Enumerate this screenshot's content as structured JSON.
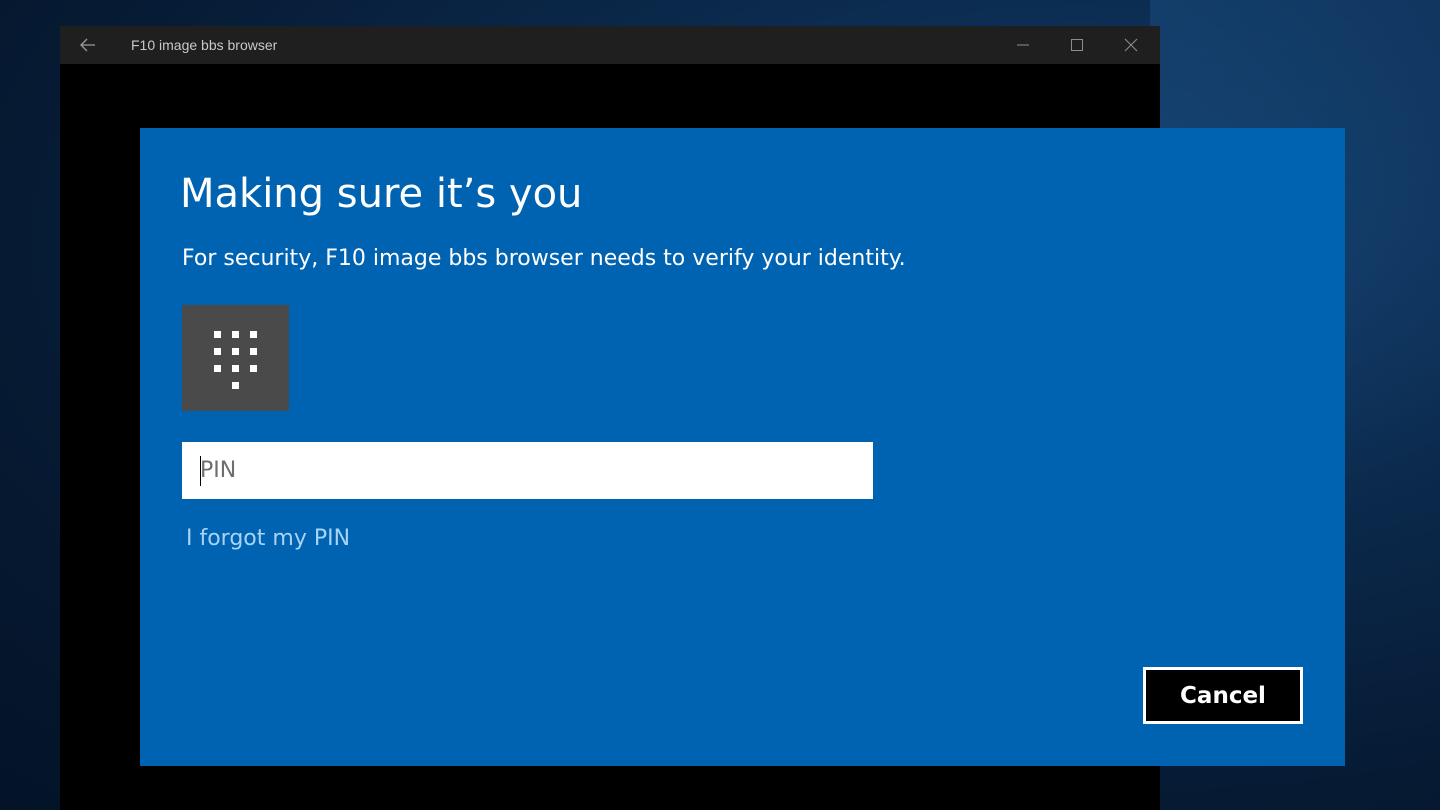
{
  "window": {
    "title": "F10 image bbs browser",
    "back_icon": "arrow-left-icon",
    "controls": [
      "minimize-icon",
      "maximize-icon",
      "close-icon"
    ]
  },
  "dialog": {
    "title": "Making sure it’s you",
    "subtitle": "For security, F10 image bbs browser needs to verify your identity.",
    "tile_icon": "pin-keypad-icon",
    "pin_input": {
      "placeholder": "PIN",
      "value": ""
    },
    "forgot_link": "I forgot my PIN",
    "cancel_label": "Cancel"
  },
  "colors": {
    "dialog_background": "#0063b1",
    "tile_background": "#4a4a4a",
    "link": "#a7d4f5",
    "titlebar": "#1f1f1f",
    "button_background": "#000000"
  }
}
